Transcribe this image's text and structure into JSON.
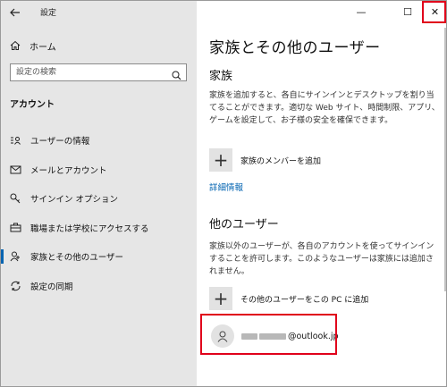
{
  "window": {
    "app_title": "設定",
    "back_icon": "arrow-left-icon",
    "controls": {
      "minimize": "—",
      "maximize": "☐",
      "close": "✕"
    },
    "highlight_color": "#e0001b"
  },
  "sidebar": {
    "home_label": "ホーム",
    "search_placeholder": "設定の検索",
    "section_title": "アカウント",
    "items": [
      {
        "label": "ユーザーの情報",
        "icon": "person-card-icon"
      },
      {
        "label": "メールとアカウント",
        "icon": "mail-icon"
      },
      {
        "label": "サインイン オプション",
        "icon": "key-icon"
      },
      {
        "label": "職場または学校にアクセスする",
        "icon": "briefcase-icon"
      },
      {
        "label": "家族とその他のユーザー",
        "icon": "people-icon",
        "active": true
      },
      {
        "label": "設定の同期",
        "icon": "sync-icon"
      }
    ],
    "accent_color": "#0063b1"
  },
  "main": {
    "page_title": "家族とその他のユーザー",
    "family": {
      "title": "家族",
      "description": "家族を追加すると、各自にサインインとデスクトップを割り当てることができます。適切な Web サイト、時間制限、アプリ、ゲームを設定して、お子様の安全を確保できます。",
      "add_label": "家族のメンバーを追加",
      "more_info": "詳細情報"
    },
    "others": {
      "title": "他のユーザー",
      "description": "家族以外のユーザーが、各自のアカウントを使ってサインインすることを許可します。このようなユーザーは家族には追加されません。",
      "add_label": "その他のユーザーをこの PC に追加",
      "user_email_suffix": "@outlook.jp"
    }
  }
}
